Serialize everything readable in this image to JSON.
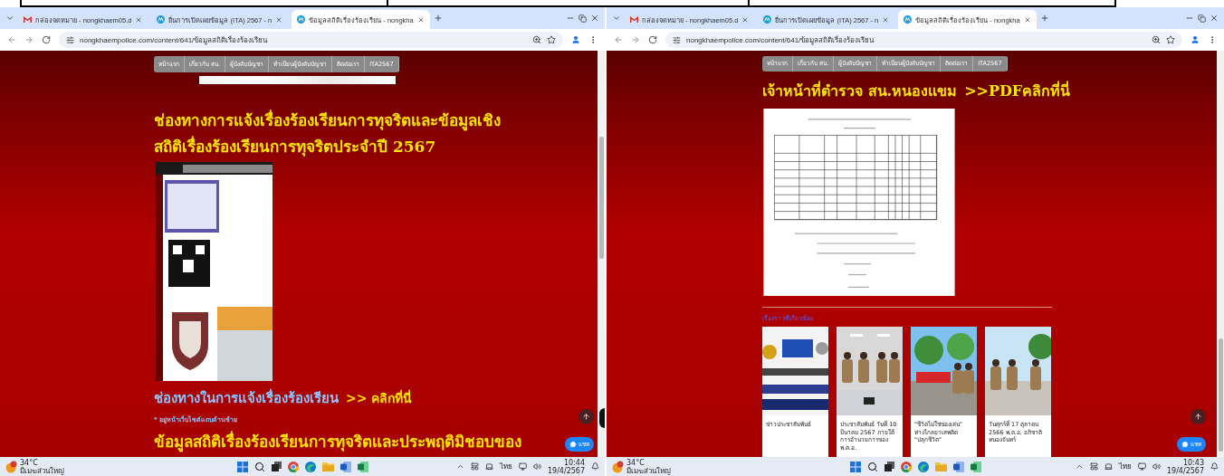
{
  "windows": [
    {
      "tabs": [
        {
          "kind": "mail",
          "title": "กล่องจดหมาย - nongkhaem05.d",
          "selected": false
        },
        {
          "kind": "site",
          "title": "ยื่นการเปิดเผยข้อมูล (ITA) 2567 - n",
          "selected": false
        },
        {
          "kind": "site",
          "title": "ข้อมูลสถิติเรื่องร้องเรียน - nongkha",
          "selected": true
        }
      ],
      "url": "nongkhaempolice.com/content/641/ข้อมูลสถิติเรื่องร้องเรียน",
      "blocks": [
        {
          "kind": "nav",
          "items": [
            "หน้าแรก",
            "เกี่ยวกับ สน.",
            "ผู้บังคับบัญชา",
            "ทำเนียบผู้บังคับบัญชา",
            "ติดต่อเรา",
            "ITA2567"
          ]
        },
        {
          "kind": "banner"
        },
        {
          "kind": "heading",
          "lines": [
            "ช่องทางการแจ้งเรื่องร้องเรียนการทุจริตและข้อมูลเชิง",
            "สถิติเรื่องร้องเรียนการทุจริตประจำปี 2567"
          ]
        },
        {
          "kind": "screenshot"
        },
        {
          "kind": "link_line",
          "text": "ช่องทางในการแจ้งเรื่องร้องเรียน",
          "link": ">> คลิกที่นี่"
        },
        {
          "kind": "note",
          "text": "* อยู่หน้าเว็บไซต์แถบด้านซ้าย"
        },
        {
          "kind": "heading",
          "lines": [
            "ข้อมูลสถิติเรื่องร้องเรียนการทุจริตและประพฤติมิชอบของ"
          ]
        }
      ],
      "chat": "แชท",
      "taskbar": {
        "temp": "34°C",
        "weather": "มีเมฆส่วนใหญ่",
        "lang": "ไทย",
        "time": "10:44",
        "date": "19/4/2567"
      }
    },
    {
      "tabs": [
        {
          "kind": "mail",
          "title": "กล่องจดหมาย - nongkhaem05.d",
          "selected": false
        },
        {
          "kind": "site",
          "title": "ยื่นการเปิดเผยข้อมูล (ITA) 2567 - n",
          "selected": false
        },
        {
          "kind": "site",
          "title": "ข้อมูลสถิติเรื่องร้องเรียน - nongkha",
          "selected": true
        }
      ],
      "url": "nongkhaempolice.com/content/641/ข้อมูลสถิติเรื่องร้องเรียน",
      "blocks": [
        {
          "kind": "nav",
          "items": [
            "หน้าแรก",
            "เกี่ยวกับ สน.",
            "ผู้บังคับบัญชา",
            "ทำเนียบผู้บังคับบัญชา",
            "ติดต่อเรา",
            "ITA2567"
          ]
        },
        {
          "kind": "heading_link",
          "text": "เจ้าหน้าที่ตำรวจ สน.หนองแขม",
          "link": ">>PDFคลิกที่นี่"
        },
        {
          "kind": "document"
        },
        {
          "kind": "divider"
        },
        {
          "kind": "section_label",
          "text": "เรื่องราวที่เกี่ยวข้อง"
        },
        {
          "kind": "cards",
          "items": [
            {
              "caption": "ข่าวประชาสัมพันธ์"
            },
            {
              "caption": "ประชาสัมพันธ์ วันที่ 10 มีนาคม 2567 ภายใต้การอำนวยการของ พ.ต.อ."
            },
            {
              "caption": "\"ชีวิตไม่ใช่ของเล่น\" ห่างไกลยาเสพติด \"ปลุกชีวิต\""
            },
            {
              "caption": "วันศุกร์ที่ 17 ตุลาคม 2566 พ.ต.อ. อภิชาติ หนองจันทร์"
            }
          ]
        }
      ],
      "chat": "แชท",
      "taskbar": {
        "temp": "34°C",
        "weather": "มีเมฆส่วนใหญ่",
        "lang": "ไทย",
        "time": "10:43",
        "date": "19/4/2567"
      }
    }
  ]
}
